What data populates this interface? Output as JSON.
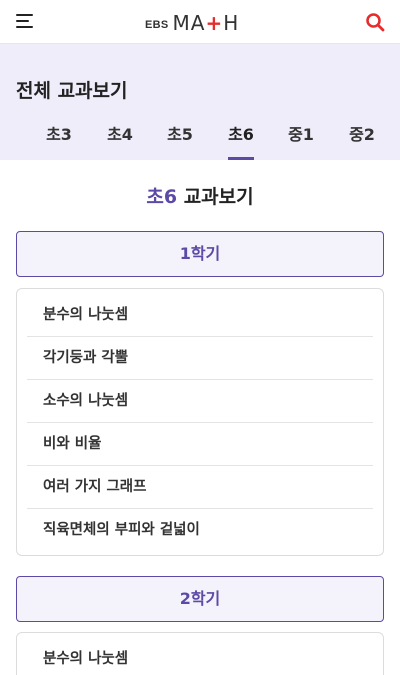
{
  "header": {
    "logo_prefix": "EBS",
    "logo_m": "M",
    "logo_a": "A",
    "logo_plus": "+",
    "logo_h": "H",
    "menu_icon": "hamburger-menu-icon",
    "search_icon": "search-icon"
  },
  "category": {
    "title": "전체 교과보기",
    "tabs": [
      {
        "label": "초3",
        "active": false
      },
      {
        "label": "초4",
        "active": false
      },
      {
        "label": "초5",
        "active": false
      },
      {
        "label": "초6",
        "active": true
      },
      {
        "label": "중1",
        "active": false
      },
      {
        "label": "중2",
        "active": false
      }
    ]
  },
  "main": {
    "heading_grade": "초6",
    "heading_text": "교과보기",
    "semesters": [
      {
        "label": "1학기",
        "units": [
          "분수의 나눗셈",
          "각기둥과 각뿔",
          "소수의 나눗셈",
          "비와 비율",
          "여러 가지 그래프",
          "직육면체의 부피와 겉넓이"
        ]
      },
      {
        "label": "2학기",
        "units": [
          "분수의 나눗셈"
        ]
      }
    ]
  },
  "colors": {
    "accent": "#5c4aa6",
    "category_bg": "#efedf9",
    "search_red": "#e52d2d"
  }
}
